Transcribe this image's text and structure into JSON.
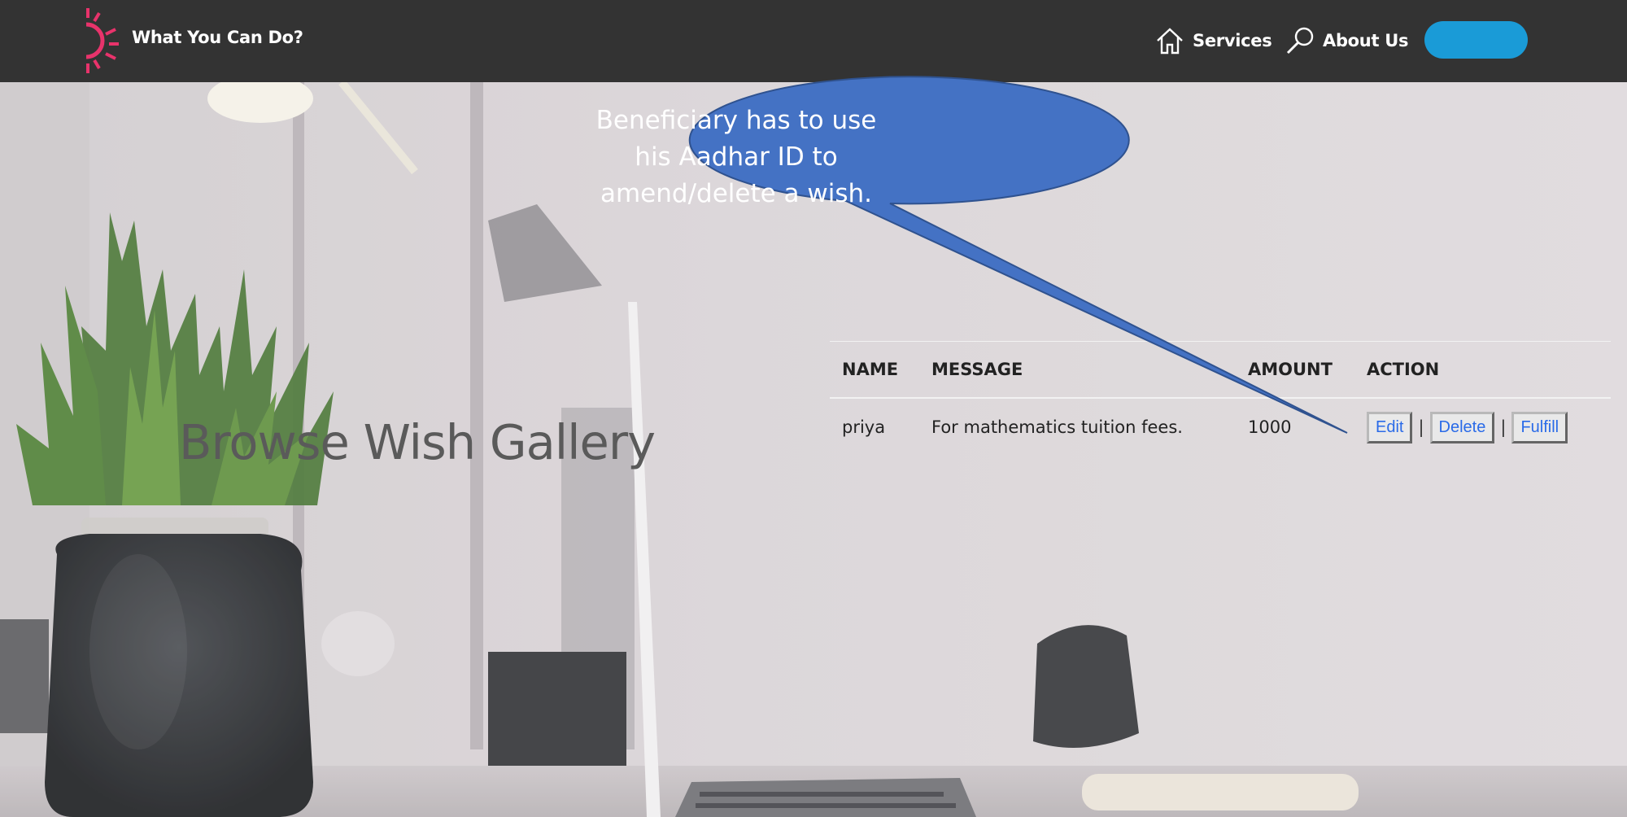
{
  "navbar": {
    "brand": "What You Can Do?",
    "logo_icon": "sunrise-icon",
    "items": [
      {
        "label": "Services",
        "icon": "home-icon"
      },
      {
        "label": "About Us",
        "icon": "search-icon"
      }
    ],
    "cta_color": "#1a9bd7"
  },
  "page": {
    "title": "Browse Wish Gallery"
  },
  "table": {
    "headers": [
      "NAME",
      "MESSAGE",
      "AMOUNT",
      "ACTION"
    ],
    "rows": [
      {
        "name": "priya",
        "message": "For mathematics tuition fees.",
        "amount": "1000",
        "actions": [
          "Edit",
          "Delete",
          "Fulfill"
        ],
        "separator": "|"
      }
    ]
  },
  "callout": {
    "lines": [
      "Beneficiary has to use",
      "his Aadhar ID to",
      "amend/delete a wish."
    ],
    "color": "#4472c4"
  },
  "colors": {
    "navbar_bg": "#333333",
    "logo_accent": "#e8336b",
    "link_blue": "#2a6be8"
  }
}
